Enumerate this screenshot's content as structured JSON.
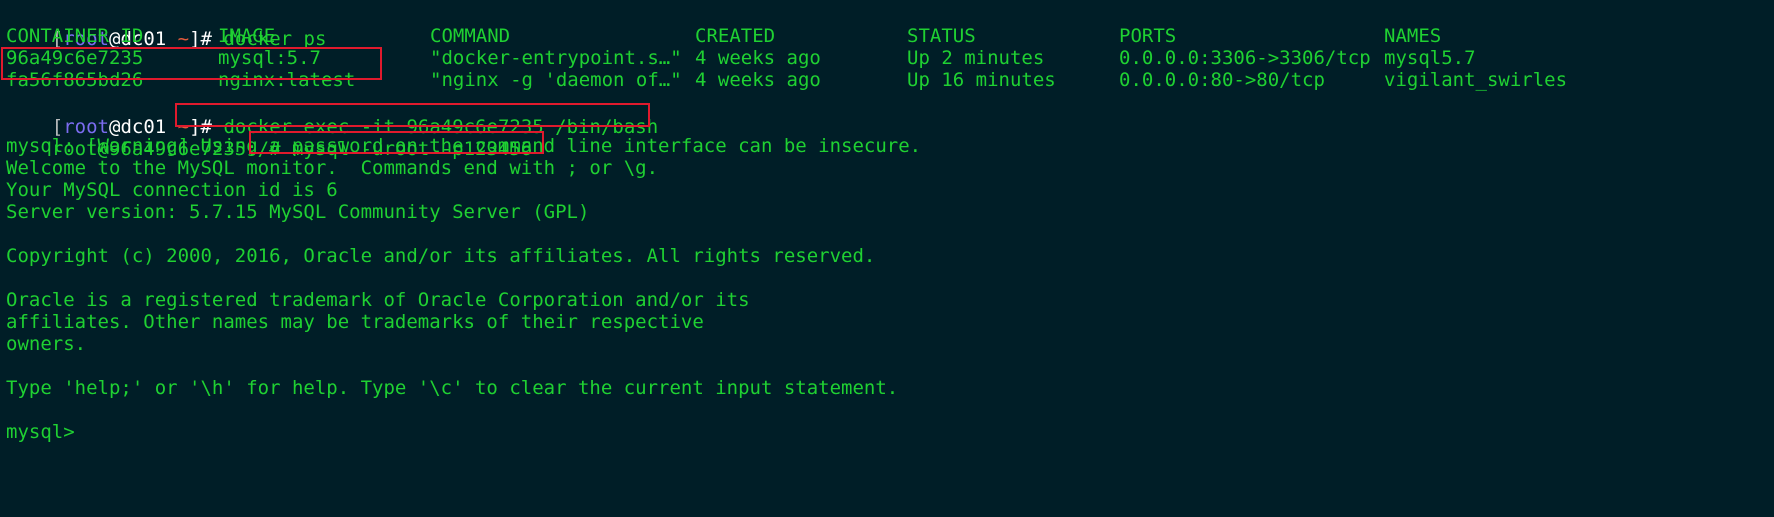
{
  "prompt": {
    "open": "[",
    "user": "root",
    "at": "@",
    "host": "dc01",
    "tilde": "~",
    "close": "]#"
  },
  "commands": {
    "docker_ps": "docker ps",
    "docker_exec": "docker exec -it 96a49c6e7235 /bin/bash",
    "mysql_login": "mysql -uroot -p123456"
  },
  "container_prompt": "root@96a49c6e7235:/#",
  "table": {
    "headers": [
      "CONTAINER ID",
      "IMAGE",
      "COMMAND",
      "CREATED",
      "STATUS",
      "PORTS",
      "NAMES"
    ],
    "rows": [
      [
        "96a49c6e7235",
        "mysql:5.7",
        "\"docker-entrypoint.s…\"",
        "4 weeks ago",
        "Up 2 minutes",
        "0.0.0.0:3306->3306/tcp",
        "mysql5.7"
      ],
      [
        "fa56f865bd26",
        "nginx:latest",
        "\"nginx -g 'daemon of…\"",
        "4 weeks ago",
        "Up 16 minutes",
        "0.0.0.0:80->80/tcp",
        "vigilant_swirles"
      ]
    ]
  },
  "output": [
    "mysql: [Warning] Using a password on the command line interface can be insecure.",
    "Welcome to the MySQL monitor.  Commands end with ; or \\g.",
    "Your MySQL connection id is 6",
    "Server version: 5.7.15 MySQL Community Server (GPL)",
    "",
    "Copyright (c) 2000, 2016, Oracle and/or its affiliates. All rights reserved.",
    "",
    "Oracle is a registered trademark of Oracle Corporation and/or its",
    "affiliates. Other names may be trademarks of their respective",
    "owners.",
    "",
    "Type 'help;' or '\\h' for help. Type '\\c' to clear the current input statement.",
    "",
    "mysql>"
  ],
  "colors": {
    "background": "#001e27",
    "text": "#1fd132",
    "user": "#7b6cf0",
    "tilde": "#e25a3c",
    "highlight_box": "#e01a2d"
  }
}
